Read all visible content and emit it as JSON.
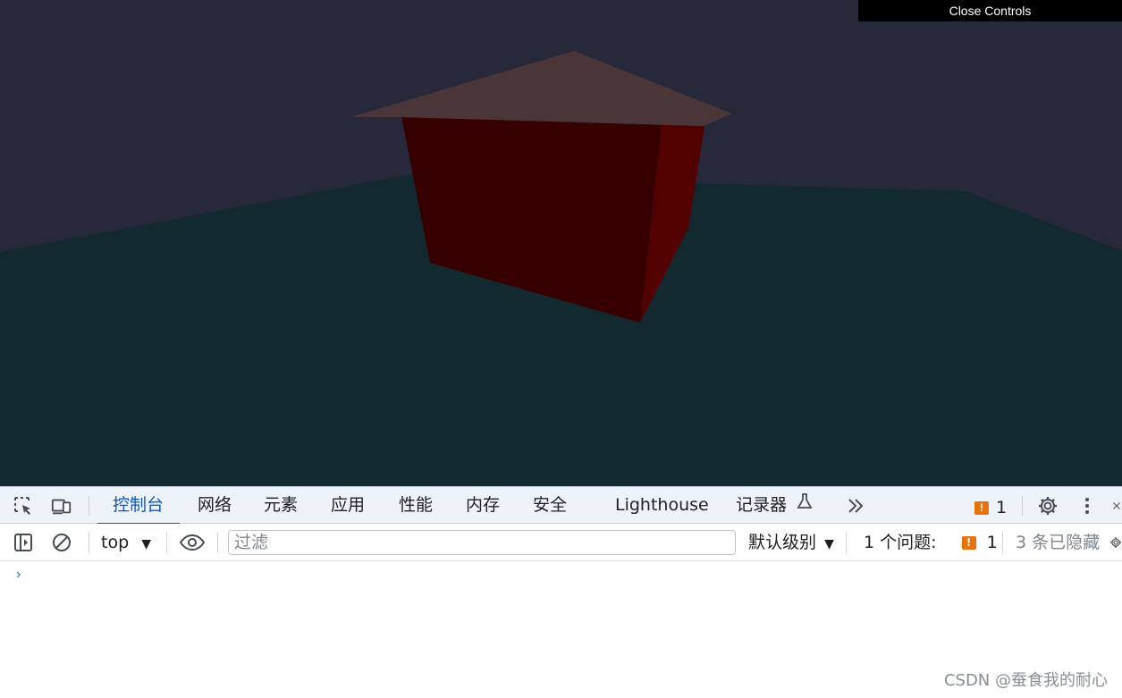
{
  "scene": {
    "colors": {
      "sky": "#27283a",
      "ground": "#132930",
      "roof": "#4a3539",
      "wall_front": "#370000",
      "wall_side": "#530000"
    },
    "close_controls_label": "Close Controls"
  },
  "devtools": {
    "tabs": [
      {
        "label": "控制台",
        "active": true
      },
      {
        "label": "网络"
      },
      {
        "label": "元素"
      },
      {
        "label": "应用"
      },
      {
        "label": "性能"
      },
      {
        "label": "内存"
      },
      {
        "label": "安全"
      },
      {
        "label": "Lighthouse"
      },
      {
        "label": "记录器"
      }
    ],
    "icons": {
      "inspect": "inspect-element-icon",
      "device": "device-toolbar-icon",
      "flask": "flask-icon",
      "more_tabs": "chevron-double-right-icon",
      "issues": "issue-badge-icon",
      "settings": "gear-icon",
      "menu": "kebab-menu-icon",
      "close": "close-icon"
    },
    "issues_count": "1",
    "accent_color": "#0b57d0",
    "warning_color": "#e8710a"
  },
  "console_toolbar": {
    "context": "top",
    "filter_placeholder": "过滤",
    "level": "默认级别",
    "issues_label": "1 个问题:",
    "issues_count": "1",
    "hidden_label": "3 条已隐藏"
  },
  "console": {
    "prompt_symbol": "›"
  },
  "watermark": "CSDN @蚕食我的耐心"
}
